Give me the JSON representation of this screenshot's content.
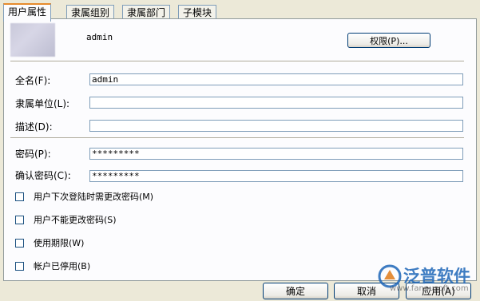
{
  "tabs": [
    "用户属性",
    "隶属组别",
    "隶属部门",
    "子模块"
  ],
  "header": {
    "username": "admin",
    "permission_button": "权限(P)..."
  },
  "fields": {
    "fullname": {
      "label": "全名(F):",
      "value": "admin"
    },
    "unit": {
      "label": "隶属单位(L):",
      "value": ""
    },
    "description": {
      "label": "描述(D):",
      "value": ""
    },
    "password": {
      "label": "密码(P):",
      "value": "*********"
    },
    "confirm": {
      "label": "确认密码(C):",
      "value": "*********"
    }
  },
  "checkboxes": [
    {
      "label": "用户下次登陆时需更改密码(M)",
      "checked": false
    },
    {
      "label": "用户不能更改密码(S)",
      "checked": false
    },
    {
      "label": "使用期限(W)",
      "checked": false
    },
    {
      "label": "帐户已停用(B)",
      "checked": false
    }
  ],
  "buttons": {
    "ok": "确定",
    "cancel": "取消",
    "apply": "应用(A)"
  },
  "watermark": {
    "text": "泛普软件",
    "url": "www.fanpusoft.com"
  }
}
